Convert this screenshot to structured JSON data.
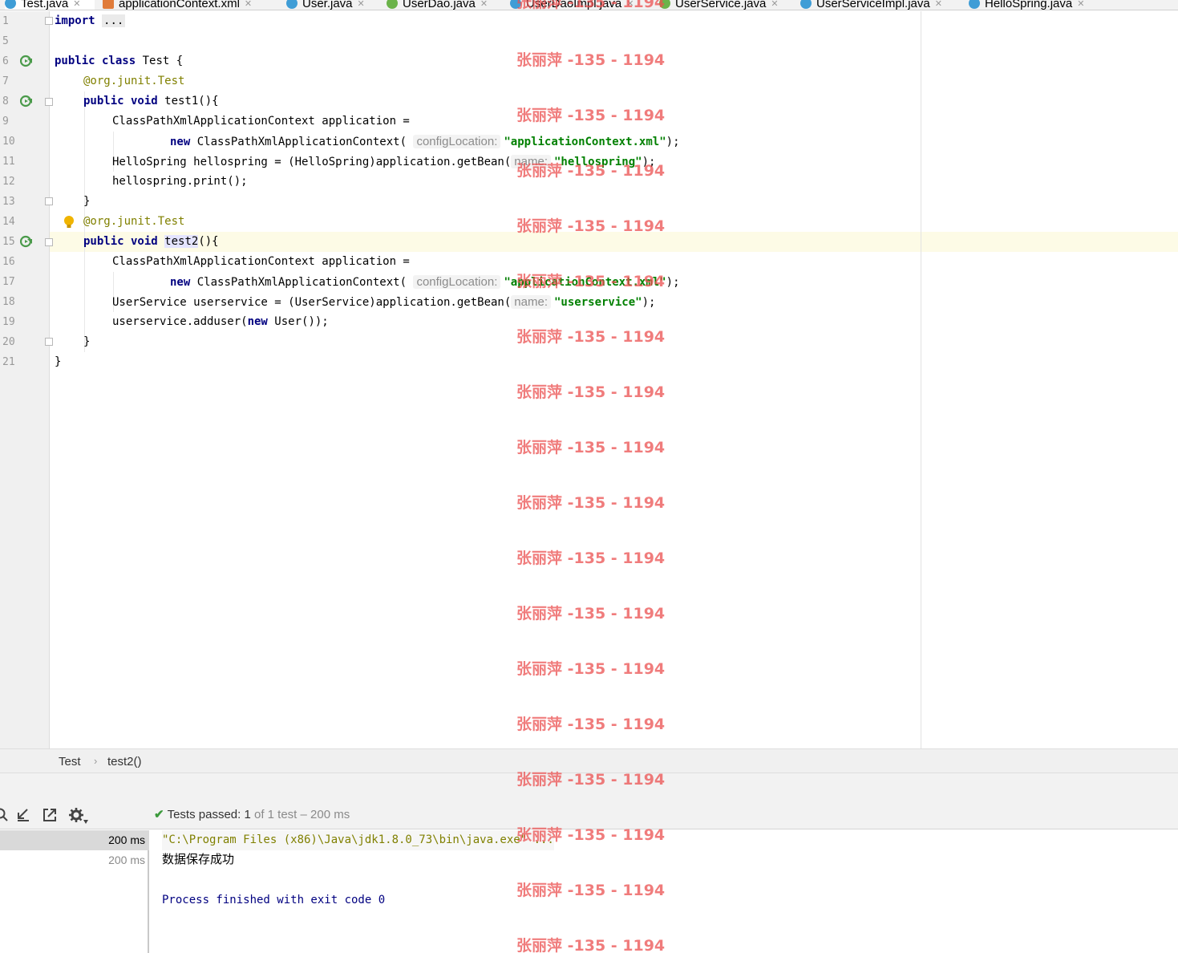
{
  "tabs": [
    {
      "label": "Test.java",
      "icon": "java-class-icon",
      "color": "#3f9dd6",
      "active": true
    },
    {
      "label": "applicationContext.xml",
      "icon": "xml-file-icon",
      "color": "#e07b39",
      "active": false
    },
    {
      "label": "User.java",
      "icon": "java-class-icon",
      "color": "#3f9dd6",
      "active": false
    },
    {
      "label": "UserDao.java",
      "icon": "java-interface-icon",
      "color": "#6bb34a",
      "active": false
    },
    {
      "label": "UserDaoImpl.java",
      "icon": "java-class-icon",
      "color": "#3f9dd6",
      "active": false
    },
    {
      "label": "UserService.java",
      "icon": "java-interface-icon",
      "color": "#6bb34a",
      "active": false
    },
    {
      "label": "UserServiceImpl.java",
      "icon": "java-class-icon",
      "color": "#3f9dd6",
      "active": false
    },
    {
      "label": "HelloSpring.java",
      "icon": "java-class-icon",
      "color": "#3f9dd6",
      "active": false
    }
  ],
  "line_numbers": [
    "1",
    "5",
    "6",
    "7",
    "8",
    "9",
    "10",
    "11",
    "12",
    "13",
    "14",
    "15",
    "16",
    "17",
    "18",
    "19",
    "20",
    "21"
  ],
  "code": {
    "l1_kw": "import",
    "l1_fold": "...",
    "l6_kw": "public class",
    "l6_rest": " Test {",
    "l7_ann": "@org.junit.",
    "l7_annref": "Test",
    "l8_kw": "public void",
    "l8_rest": " test1(){",
    "l9": "ClassPathXmlApplicationContext application =",
    "l10_kw": "new",
    "l10_rest": " ClassPathXmlApplicationContext(",
    "l10_hint": "configLocation:",
    "l10_str": "\"applicationContext.xml\"",
    "l10_end": ");",
    "l11_rest": "HelloSpring hellospring = (HelloSpring)application.getBean(",
    "l11_hint": "name:",
    "l11_str": "\"hellospring\"",
    "l11_end": ");",
    "l12": "hellospring.print();",
    "l13": "}",
    "l14_ann": "@org.junit.",
    "l14_annref": "Test",
    "l15_kw": "public void",
    "l15_name": "test2",
    "l15_end": "(){",
    "l16": "ClassPathXmlApplicationContext application =",
    "l17_kw": "new",
    "l17_rest": " ClassPathXmlApplicationContext(",
    "l17_hint": "configLocation:",
    "l17_str": "\"applicationContext.xml\"",
    "l17_end": ");",
    "l18_rest": "UserService userservice = (UserService)application.getBean(",
    "l18_hint": "name:",
    "l18_str": "\"userservice\"",
    "l18_end": ");",
    "l19_a": "userservice.adduser(",
    "l19_kw": "new",
    "l19_b": " User());",
    "l20": "}",
    "l21": "}"
  },
  "breadcrumb": {
    "class": "Test",
    "sep": "›",
    "method": "test2()"
  },
  "run": {
    "status_prefix": "Tests passed:",
    "status_count": "1",
    "status_suffix": "of 1 test – 200 ms",
    "tree": [
      "200 ms",
      "200 ms"
    ],
    "console_cmd": "\"C:\\Program Files (x86)\\Java\\jdk1.8.0_73\\bin\\java.exe\" ...",
    "console_out": "数据保存成功",
    "console_exit": "Process finished with exit code 0"
  },
  "watermark": "张丽萍 -135 - 1194",
  "colors": {
    "keyword": "#000080",
    "string": "#008000",
    "annotation": "#808000",
    "pass_check": "#3c9a3c",
    "watermark": "#eb5050"
  }
}
